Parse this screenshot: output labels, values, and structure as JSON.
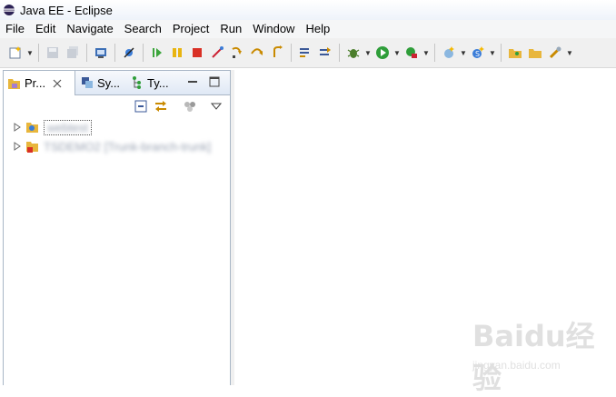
{
  "window": {
    "title": "Java EE - Eclipse"
  },
  "menu": [
    "File",
    "Edit",
    "Navigate",
    "Search",
    "Project",
    "Run",
    "Window",
    "Help"
  ],
  "toolbar": {
    "buttons": [
      "new-icon",
      "save-icon",
      "save-all-icon",
      "print-icon",
      "skip-breakpoints-icon",
      "resume-icon",
      "suspend-icon",
      "terminate-icon",
      "disconnect-icon",
      "step-into-icon",
      "step-over-icon",
      "step-return-icon",
      "use-step-filters-icon",
      "drop-to-frame-icon",
      "debug-icon",
      "run-icon",
      "external-tools-icon",
      "new-web-service-icon",
      "new-server-icon",
      "open-type-icon",
      "open-task-icon",
      "search-icon"
    ]
  },
  "left_panel": {
    "tabs": [
      {
        "label": "Pr...",
        "icon": "package-explorer-icon",
        "active": true
      },
      {
        "label": "Sy...",
        "icon": "synchronize-icon",
        "active": false
      },
      {
        "label": "Ty...",
        "icon": "type-hierarchy-icon",
        "active": false
      }
    ],
    "tree": [
      {
        "label": "webtest",
        "blurred": true,
        "selected": true
      },
      {
        "label": "TSDEMO2",
        "suffix": "[Trunk-branch-trunk]",
        "blurred": true,
        "selected": false
      }
    ]
  },
  "watermark": {
    "brand": "Baidu经验",
    "url": "jingyan.baidu.com"
  },
  "colors": {
    "accent": "#a9b6c6",
    "toolbar": "#f0f0f0",
    "menubar": "#f5f6f7"
  }
}
